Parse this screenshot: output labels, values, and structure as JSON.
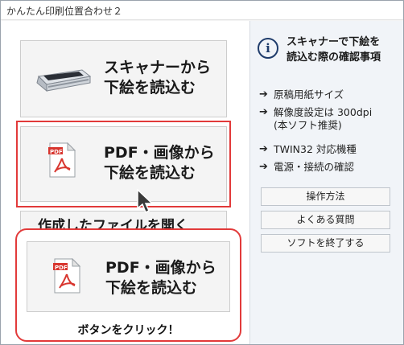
{
  "window": {
    "title": "かんたん印刷位置合わせ２"
  },
  "main": {
    "scanner_button": {
      "line1": "スキャナーから",
      "line2": "下絵を読込む",
      "icon": "scanner-icon"
    },
    "pdf_button": {
      "line1": "PDF・画像から",
      "line2": "下絵を読込む",
      "icon": "pdf-file-icon"
    },
    "open_file_button": {
      "label": "作成したファイルを開く"
    }
  },
  "side": {
    "info_title_line1": "スキャナーで下絵を",
    "info_title_line2": "読込む際の確認事項",
    "links": [
      {
        "label": "原稿用紙サイズ"
      },
      {
        "label": "解像度設定は 300dpi",
        "sub": "(本ソフト推奨)"
      },
      {
        "label": "TWIN32 対応機種"
      },
      {
        "label": "電源・接続の確認"
      }
    ],
    "buttons": {
      "howto": "操作方法",
      "faq": "よくある質問",
      "exit": "ソフトを終了する"
    }
  },
  "callout": {
    "button_line1": "PDF・画像から",
    "button_line2": "下絵を読込む",
    "caption": "ボタンをクリック！"
  },
  "colors": {
    "highlight": "#e23a3a",
    "info_icon": "#1f3c6b"
  }
}
